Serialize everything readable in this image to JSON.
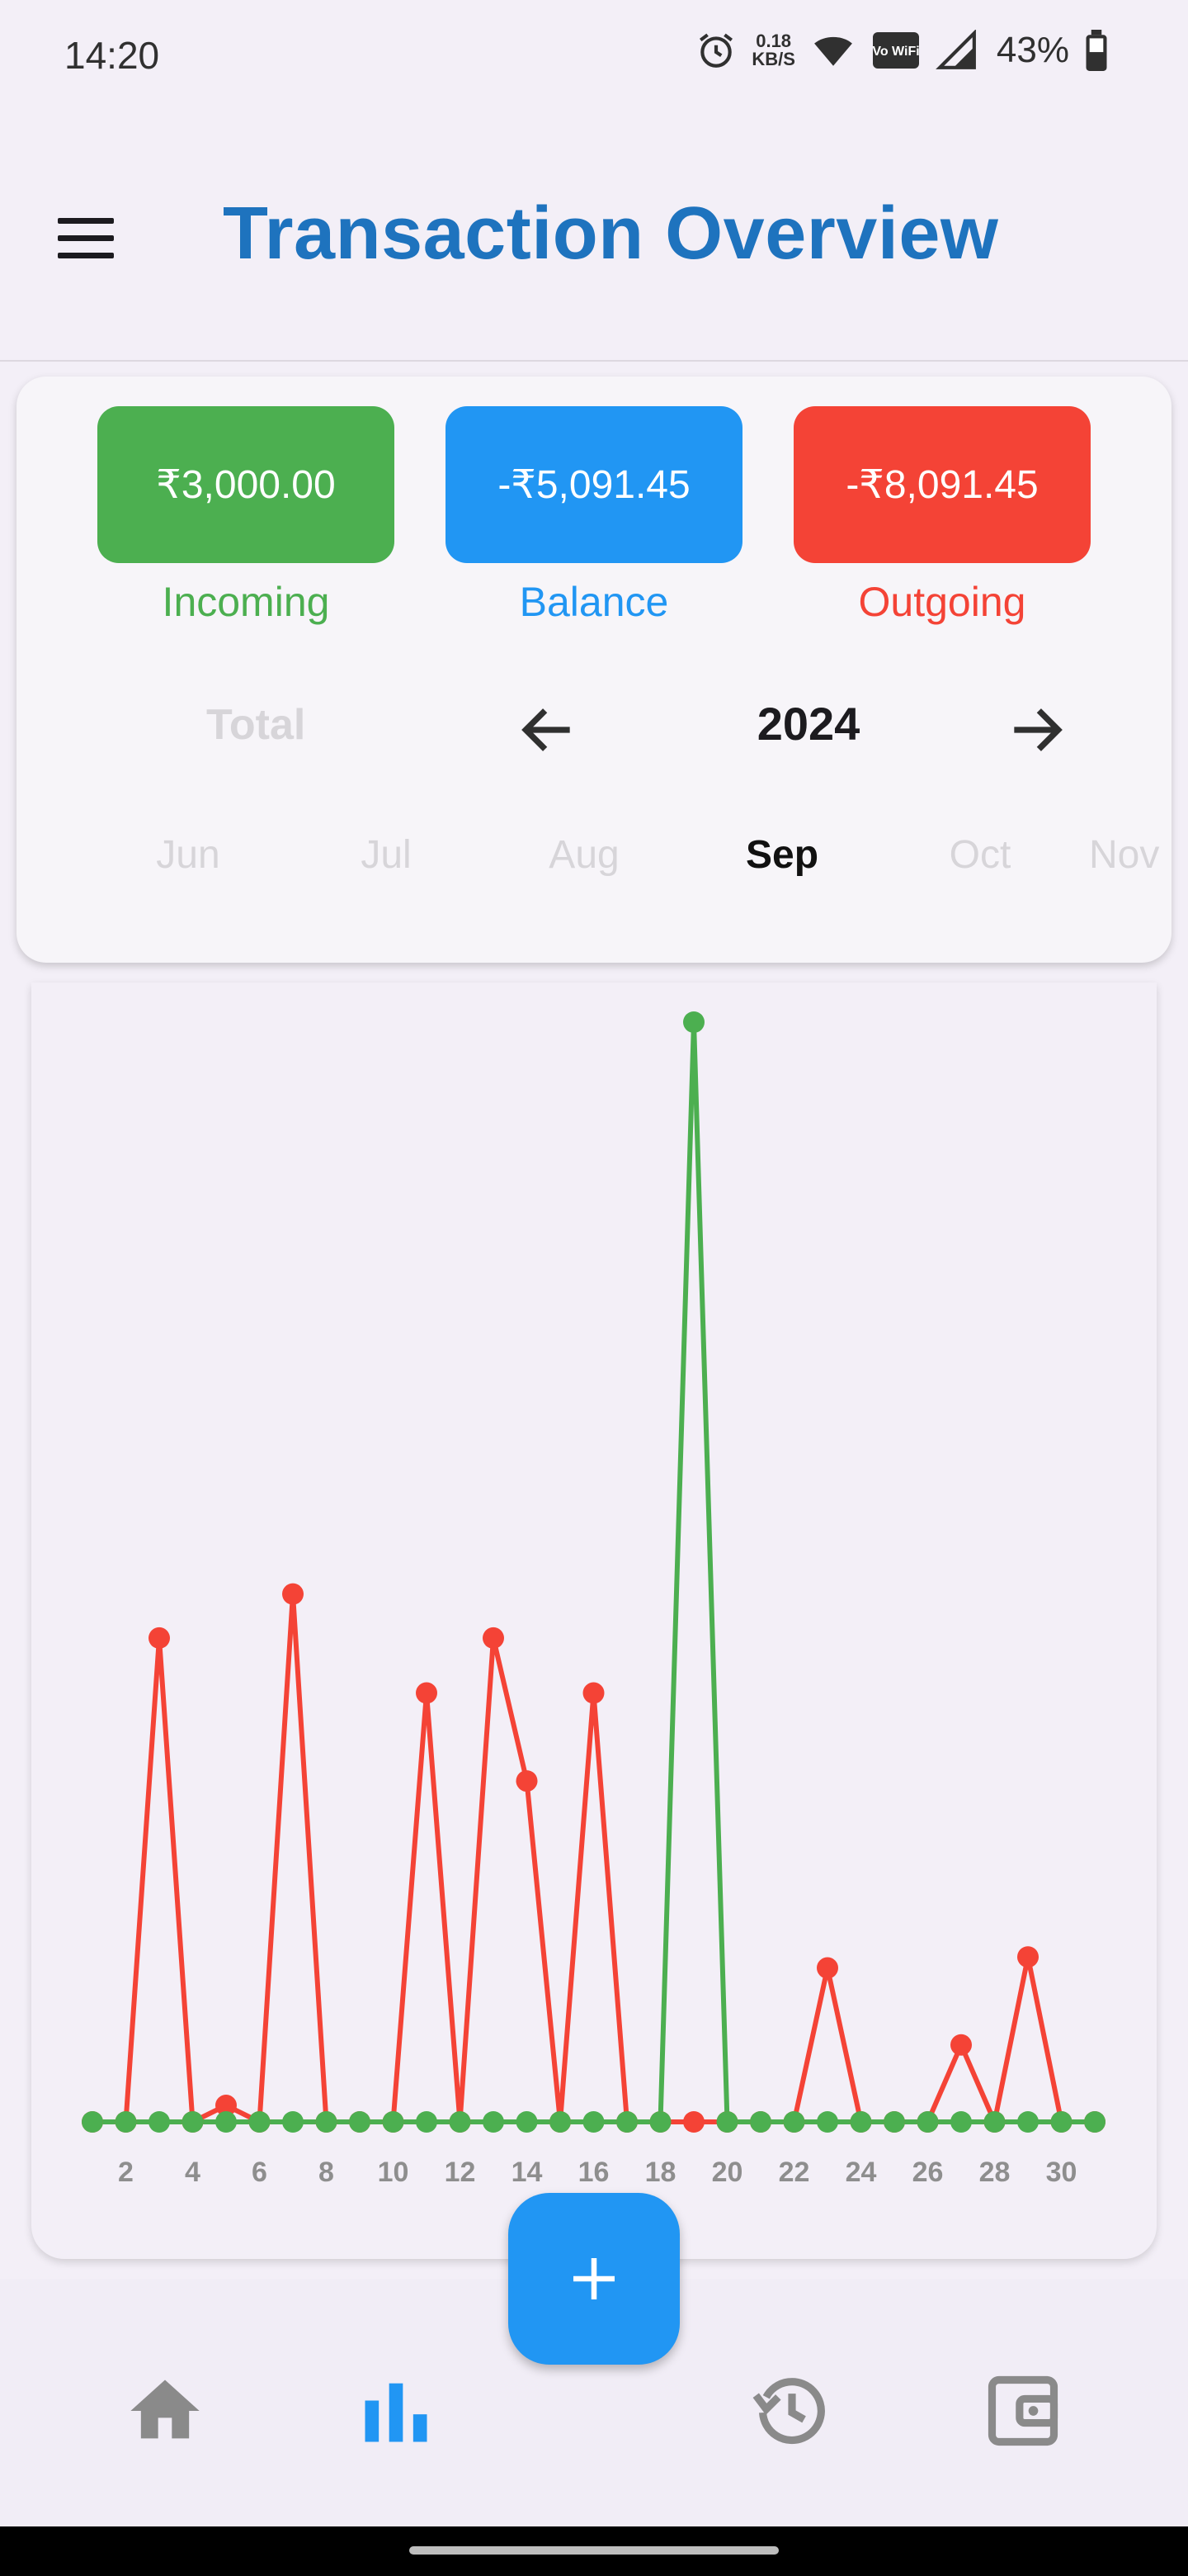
{
  "status_bar": {
    "time": "14:20",
    "net_rate_value": "0.18",
    "net_rate_unit": "KB/S",
    "volte_label": "Vo WiFi",
    "battery_percent": "43%"
  },
  "header": {
    "title": "Transaction Overview",
    "menu_icon": "hamburger-menu-icon"
  },
  "summary": {
    "incoming": {
      "amount": "₹3,000.00",
      "label": "Incoming",
      "color": "#4caf50"
    },
    "balance": {
      "amount": "-₹5,091.45",
      "label": "Balance",
      "color": "#2196f3"
    },
    "outgoing": {
      "amount": "-₹8,091.45",
      "label": "Outgoing",
      "color": "#f44336"
    }
  },
  "period": {
    "total_label": "Total",
    "year": "2024",
    "months": [
      "Jun",
      "Jul",
      "Aug",
      "Sep",
      "Oct",
      "Nov"
    ],
    "selected_month": "Sep"
  },
  "chart_data": {
    "type": "line",
    "x": [
      1,
      2,
      3,
      4,
      5,
      6,
      7,
      8,
      9,
      10,
      11,
      12,
      13,
      14,
      15,
      16,
      17,
      18,
      19,
      20,
      21,
      22,
      23,
      24,
      25,
      26,
      27,
      28,
      29,
      30,
      31
    ],
    "x_tick_labels": [
      "2",
      "4",
      "6",
      "8",
      "10",
      "12",
      "14",
      "16",
      "18",
      "20",
      "22",
      "24",
      "26",
      "28",
      "30"
    ],
    "ylim": [
      0,
      100
    ],
    "grid": false,
    "legend": "none",
    "series": [
      {
        "color": "#f44336",
        "values": [
          0,
          0,
          44,
          0,
          1.5,
          0,
          48,
          0,
          0,
          0,
          39,
          0,
          44,
          31,
          0,
          39,
          0,
          0,
          0,
          0,
          0,
          0,
          14,
          0,
          0,
          0,
          7,
          0,
          15,
          0,
          0
        ]
      },
      {
        "color": "#4caf50",
        "values": [
          0,
          0,
          0,
          0,
          0,
          0,
          0,
          0,
          0,
          0,
          0,
          0,
          0,
          0,
          0,
          0,
          0,
          0,
          100,
          0,
          0,
          0,
          0,
          0,
          0,
          0,
          0,
          0,
          0,
          0,
          0
        ]
      }
    ]
  },
  "fab": {
    "icon": "plus-icon"
  },
  "bottom_nav": {
    "items": [
      {
        "icon": "home-icon",
        "active": false
      },
      {
        "icon": "bar-chart-icon",
        "active": true
      },
      {
        "icon": "history-icon",
        "active": false
      },
      {
        "icon": "wallet-icon",
        "active": false
      }
    ],
    "active_color": "#2196f3",
    "inactive_color": "#8a8a8a"
  }
}
